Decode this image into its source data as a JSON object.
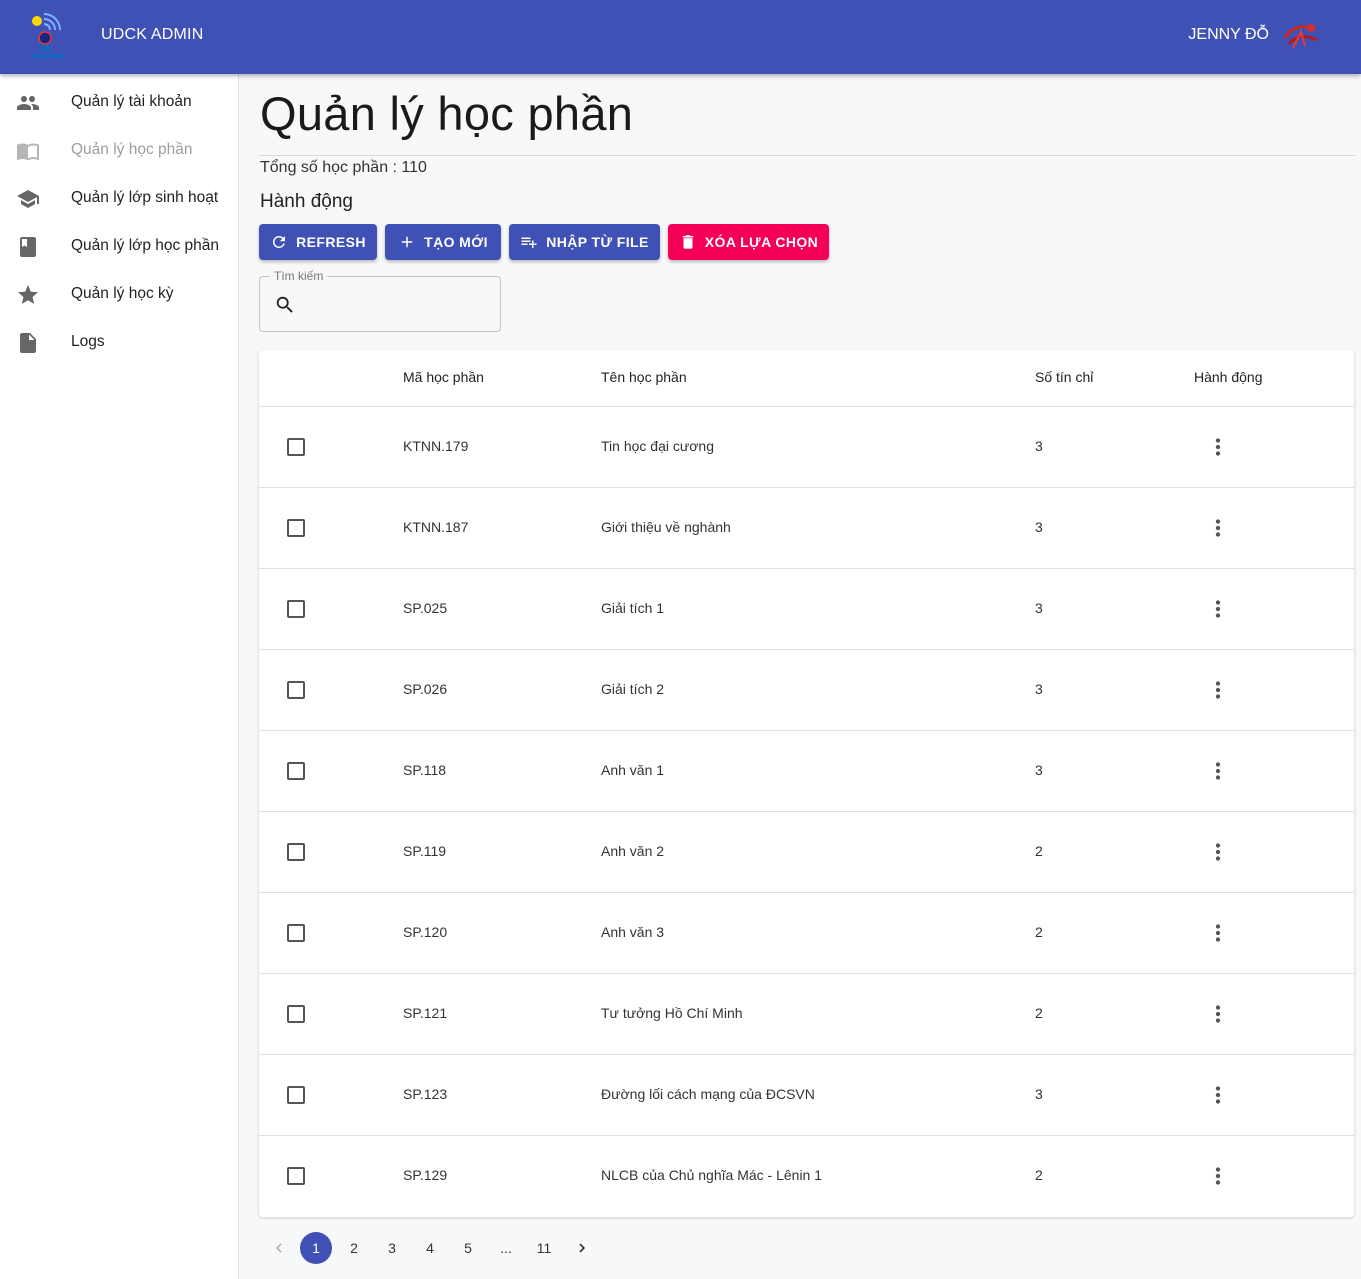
{
  "header": {
    "app_title": "UDCK ADMIN",
    "user_name": "JENNY ĐỖ"
  },
  "sidebar": {
    "items": [
      {
        "label": "Quản lý tài khoản",
        "icon": "people-icon",
        "active": false
      },
      {
        "label": "Quản lý học phần",
        "icon": "book-open-icon",
        "active": true
      },
      {
        "label": "Quản lý lớp sinh hoạt",
        "icon": "school-icon",
        "active": false
      },
      {
        "label": "Quản lý lớp học phần",
        "icon": "book-icon",
        "active": false
      },
      {
        "label": "Quản lý học kỳ",
        "icon": "star-icon",
        "active": false
      },
      {
        "label": "Logs",
        "icon": "file-icon",
        "active": false
      }
    ]
  },
  "main": {
    "title": "Quản lý học phần",
    "total_text": "Tổng số học phần : 110",
    "actions_title": "Hành động",
    "buttons": {
      "refresh": "REFRESH",
      "create": "TẠO MỚI",
      "import": "NHẬP TỪ FILE",
      "delete": "XÓA LỰA CHỌN"
    },
    "search": {
      "label": "Tìm kiếm",
      "value": ""
    }
  },
  "table": {
    "headers": {
      "code": "Mã học phần",
      "name": "Tên học phần",
      "credits": "Số tín chỉ",
      "actions": "Hành động"
    },
    "rows": [
      {
        "code": "KTNN.179",
        "name": "Tin học đại cương",
        "credits": "3",
        "checked": false
      },
      {
        "code": "KTNN.187",
        "name": "Giới thiệu về nghành",
        "credits": "3",
        "checked": false
      },
      {
        "code": "SP.025",
        "name": "Giải tích 1",
        "credits": "3",
        "checked": false
      },
      {
        "code": "SP.026",
        "name": "Giải tích 2",
        "credits": "3",
        "checked": false
      },
      {
        "code": "SP.118",
        "name": "Anh văn 1",
        "credits": "3",
        "checked": false
      },
      {
        "code": "SP.119",
        "name": "Anh văn 2",
        "credits": "2",
        "checked": false
      },
      {
        "code": "SP.120",
        "name": "Anh văn 3",
        "credits": "2",
        "checked": false
      },
      {
        "code": "SP.121",
        "name": "Tư tưởng Hồ Chí Minh",
        "credits": "2",
        "checked": false
      },
      {
        "code": "SP.123",
        "name": "Đường lối cách mạng của ĐCSVN",
        "credits": "3",
        "checked": false
      },
      {
        "code": "SP.129",
        "name": "NLCB của Chủ nghĩa Mác - Lênin 1",
        "credits": "2",
        "checked": false
      }
    ]
  },
  "pagination": {
    "pages": [
      "1",
      "2",
      "3",
      "4",
      "5",
      "...",
      "11"
    ],
    "current": "1"
  },
  "colors": {
    "primary": "#3f51b5",
    "danger": "#f50057"
  }
}
